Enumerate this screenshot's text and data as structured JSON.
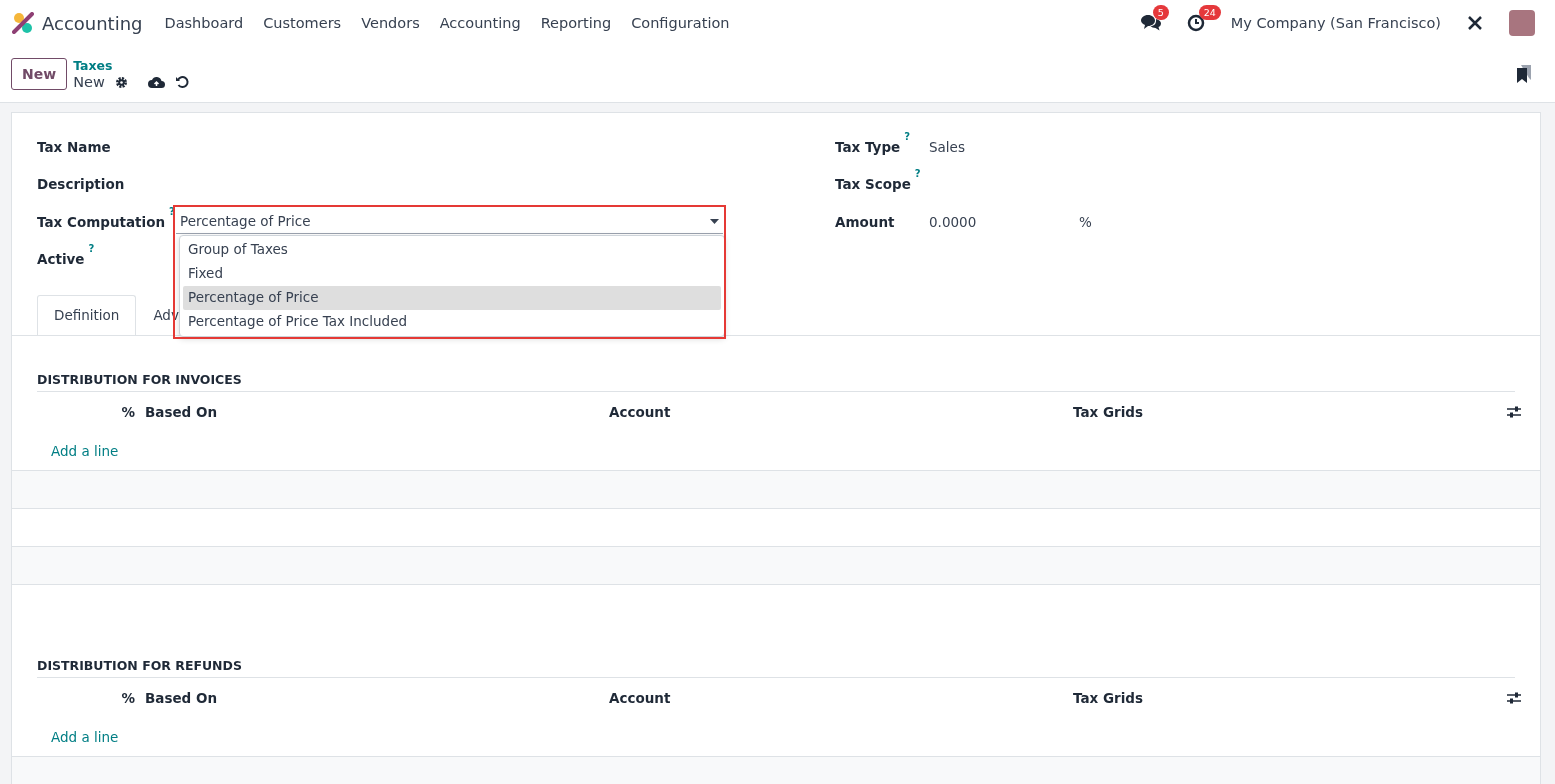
{
  "navbar": {
    "app_name": "Accounting",
    "menu": [
      "Dashboard",
      "Customers",
      "Vendors",
      "Accounting",
      "Reporting",
      "Configuration"
    ],
    "messages_badge": "5",
    "activities_badge": "24",
    "company": "My Company (San Francisco)"
  },
  "control_panel": {
    "new_button": "New",
    "breadcrumb": "Taxes",
    "record": "New"
  },
  "form": {
    "left_fields": [
      {
        "label": "Tax Name",
        "kind": "text"
      },
      {
        "label": "Description",
        "kind": "text"
      },
      {
        "label": "Tax Computation",
        "help": "?",
        "kind": "select"
      },
      {
        "label": "Active",
        "help": "?",
        "kind": "text"
      }
    ],
    "right_fields": [
      {
        "label": "Tax Type",
        "help": "?",
        "value": "Sales"
      },
      {
        "label": "Tax Scope",
        "help": "?"
      },
      {
        "label": "Amount",
        "value": "0.0000",
        "suffix": "%"
      }
    ],
    "tax_computation": {
      "value": "Percentage of Price",
      "options": [
        {
          "label": "Group of Taxes",
          "selected": false
        },
        {
          "label": "Fixed",
          "selected": false
        },
        {
          "label": "Percentage of Price",
          "selected": true
        },
        {
          "label": "Percentage of Price Tax Included",
          "selected": false
        }
      ]
    },
    "tabs": [
      {
        "label": "Definition",
        "selected": true
      },
      {
        "label": "Adv",
        "selected": false
      }
    ],
    "sections": [
      {
        "title": "DISTRIBUTION FOR INVOICES",
        "columns": [
          "%",
          "Based On",
          "Account",
          "Tax Grids"
        ],
        "add_line": "Add a line"
      },
      {
        "title": "DISTRIBUTION FOR REFUNDS",
        "columns": [
          "%",
          "Based On",
          "Account",
          "Tax Grids"
        ],
        "add_line": "Add a line"
      }
    ]
  }
}
